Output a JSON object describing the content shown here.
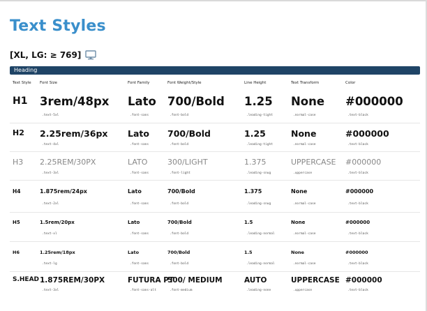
{
  "title": "Text Styles",
  "breakpoint": "[XL, LG: ≥ 769]",
  "section": "Heading",
  "columns": [
    "Text Style",
    "Font Size",
    "Font Family",
    "Font Weight/Style",
    "Line Height",
    "Text Transform",
    "Color"
  ],
  "rows": [
    {
      "style": "H1",
      "size": "3rem/48px",
      "size_cls": ".text-5xl",
      "family": "Lato",
      "family_cls": ".font-sans",
      "weight": "700/Bold",
      "weight_cls": ".font-bold",
      "line": "1.25",
      "line_cls": ".leading-tight",
      "transform": "None",
      "transform_cls": ".normal-case",
      "color": "#000000",
      "color_cls": ".text-black"
    },
    {
      "style": "H2",
      "size": "2.25rem/36px",
      "size_cls": ".text-4xl",
      "family": "Lato",
      "family_cls": ".font-sans",
      "weight": "700/Bold",
      "weight_cls": ".font-bold",
      "line": "1.25",
      "line_cls": ".leading-tight",
      "transform": "None",
      "transform_cls": ".normal-case",
      "color": "#000000",
      "color_cls": ".text-black"
    },
    {
      "style": "H3",
      "size": "2.25REM/30PX",
      "size_cls": ".text-3xl",
      "family": "LATO",
      "family_cls": ".font-sans",
      "weight": "300/LIGHT",
      "weight_cls": ".font-light",
      "line": "1.375",
      "line_cls": ".leading-snug",
      "transform": "UPPERCASE",
      "transform_cls": ".uppercase",
      "color": "#000000",
      "color_cls": ".text-black"
    },
    {
      "style": "H4",
      "size": "1.875rem/24px",
      "size_cls": ".text-2xl",
      "family": "Lato",
      "family_cls": ".font-sans",
      "weight": "700/Bold",
      "weight_cls": ".font-bold",
      "line": "1.375",
      "line_cls": ".leading-snug",
      "transform": "None",
      "transform_cls": ".normal-case",
      "color": "#000000",
      "color_cls": ".text-black"
    },
    {
      "style": "H5",
      "size": "1.5rem/20px",
      "size_cls": ".text-xl",
      "family": "Lato",
      "family_cls": ".font-sans",
      "weight": "700/Bold",
      "weight_cls": ".font-bold",
      "line": "1.5",
      "line_cls": ".leading-normal",
      "transform": "None",
      "transform_cls": ".normal-case",
      "color": "#000000",
      "color_cls": ".text-black"
    },
    {
      "style": "H6",
      "size": "1.25rem/18px",
      "size_cls": ".text-lg",
      "family": "Lato",
      "family_cls": ".font-sans",
      "weight": "700/Bold",
      "weight_cls": ".font-bold",
      "line": "1.5",
      "line_cls": ".leading-normal",
      "transform": "None",
      "transform_cls": ".normal-case",
      "color": "#000000",
      "color_cls": ".text-black"
    },
    {
      "style": "S.HEAD",
      "size": "1.875REM/30PX",
      "size_cls": ".text-3xl",
      "family": "FUTURA PT",
      "family_cls": ".font-sans-alt",
      "weight": "500/ MEDIUM",
      "weight_cls": ".font-medium",
      "line": "AUTO",
      "line_cls": ".leading-none",
      "transform": "UPPERCASE",
      "transform_cls": ".uppercase",
      "color": "#000000",
      "color_cls": ".text-black"
    }
  ],
  "colors": {
    "title": "#3a8fcb",
    "section_bar": "#1f4466"
  },
  "icons": {
    "breakpoint": "desktop-monitor-icon"
  }
}
